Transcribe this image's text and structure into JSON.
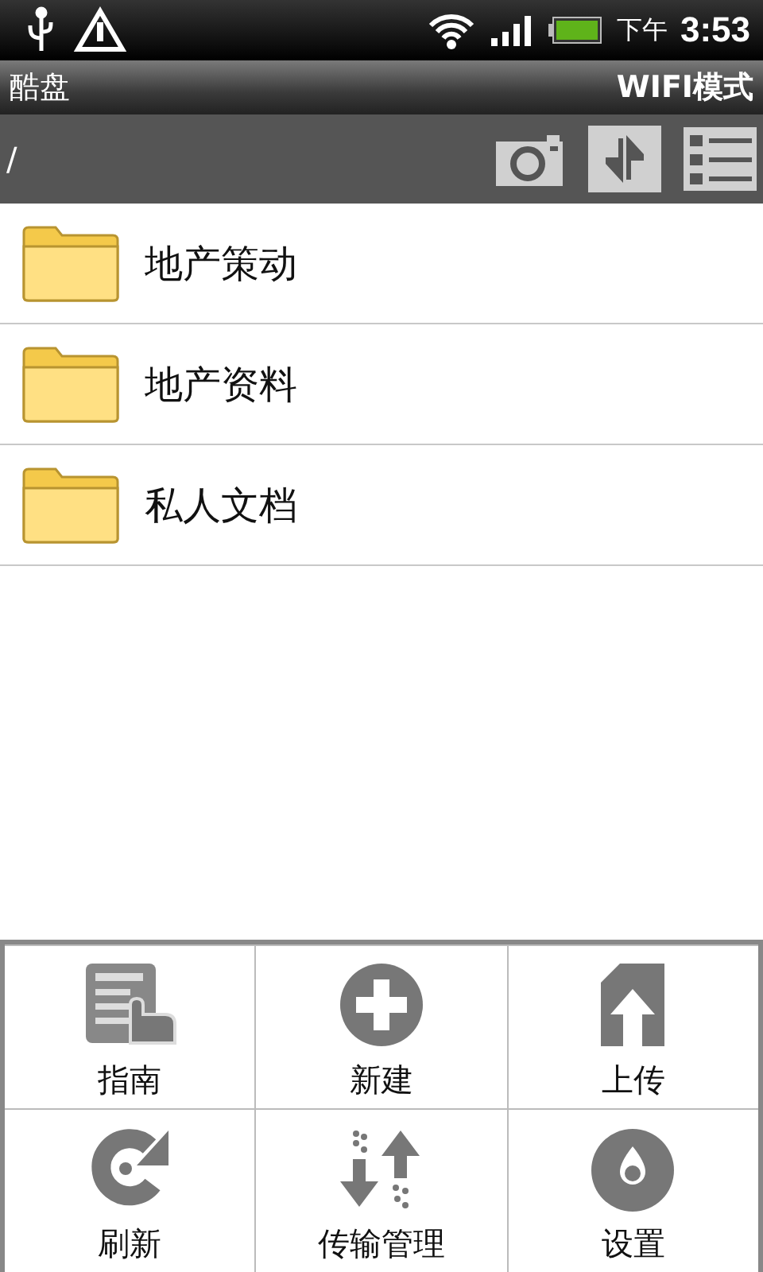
{
  "status_bar": {
    "period": "下午",
    "time": "3:53"
  },
  "title_bar": {
    "title": "酷盘",
    "mode": "WIFI模式"
  },
  "path_bar": {
    "path": "/"
  },
  "folders": [
    {
      "name": "地产策动"
    },
    {
      "name": "地产资料"
    },
    {
      "name": "私人文档"
    }
  ],
  "menu": [
    {
      "label": "指南"
    },
    {
      "label": "新建"
    },
    {
      "label": "上传"
    },
    {
      "label": "刷新"
    },
    {
      "label": "传输管理"
    },
    {
      "label": "设置"
    }
  ]
}
